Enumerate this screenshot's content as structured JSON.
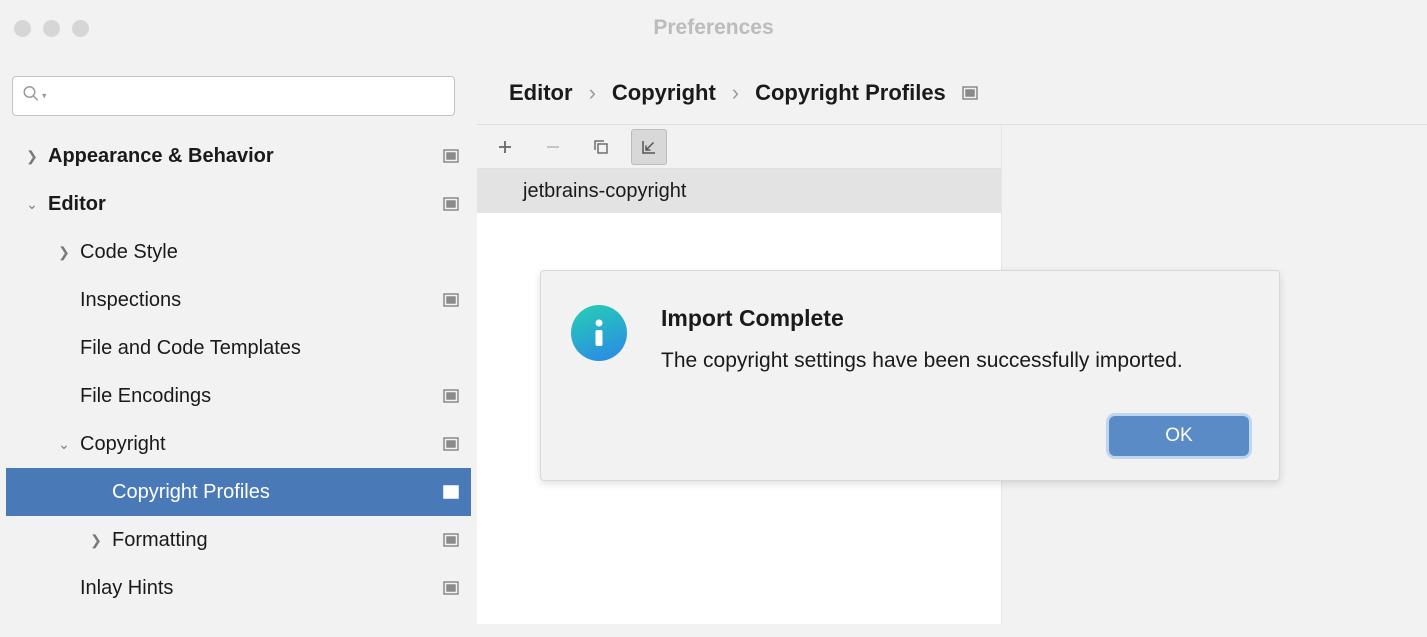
{
  "window": {
    "title": "Preferences"
  },
  "search": {
    "placeholder": ""
  },
  "sidebar": {
    "items": [
      {
        "label": "Appearance & Behavior"
      },
      {
        "label": "Editor"
      },
      {
        "label": "Code Style"
      },
      {
        "label": "Inspections"
      },
      {
        "label": "File and Code Templates"
      },
      {
        "label": "File Encodings"
      },
      {
        "label": "Copyright"
      },
      {
        "label": "Copyright Profiles"
      },
      {
        "label": "Formatting"
      },
      {
        "label": "Inlay Hints"
      }
    ]
  },
  "breadcrumb": {
    "a": "Editor",
    "b": "Copyright",
    "c": "Copyright Profiles"
  },
  "profiles": {
    "items": [
      {
        "name": "jetbrains-copyright"
      }
    ]
  },
  "dialog": {
    "title": "Import Complete",
    "message": "The copyright settings have been successfully imported.",
    "ok": "OK"
  }
}
